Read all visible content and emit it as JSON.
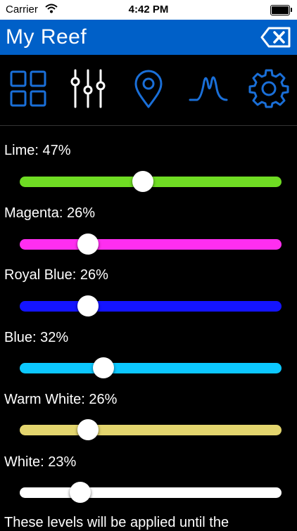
{
  "status_bar": {
    "carrier": "Carrier",
    "time": "4:42 PM"
  },
  "header": {
    "title": "My Reef",
    "delete_icon": "delete-backspace-icon"
  },
  "tabs": [
    {
      "icon": "grid-icon",
      "selected": false
    },
    {
      "icon": "sliders-icon",
      "selected": true
    },
    {
      "icon": "location-pin-icon",
      "selected": false
    },
    {
      "icon": "spectrum-icon",
      "selected": false
    },
    {
      "icon": "gear-icon",
      "selected": false
    }
  ],
  "channels": [
    {
      "label": "Lime: 47%",
      "value": 47,
      "color": "#6fdc23"
    },
    {
      "label": "Magenta: 26%",
      "value": 26,
      "color": "#ff2ef0"
    },
    {
      "label": "Royal Blue: 26%",
      "value": 26,
      "color": "#1414ff"
    },
    {
      "label": "Blue: 32%",
      "value": 32,
      "color": "#0cc8ff"
    },
    {
      "label": "Warm White: 26%",
      "value": 26,
      "color": "#e3d56e"
    },
    {
      "label": "White: 23%",
      "value": 23,
      "color": "#ffffff"
    }
  ],
  "footer": {
    "text": "These levels will be applied until the"
  },
  "colors": {
    "accent": "#0060c8",
    "icon": "#1a6fd8"
  }
}
